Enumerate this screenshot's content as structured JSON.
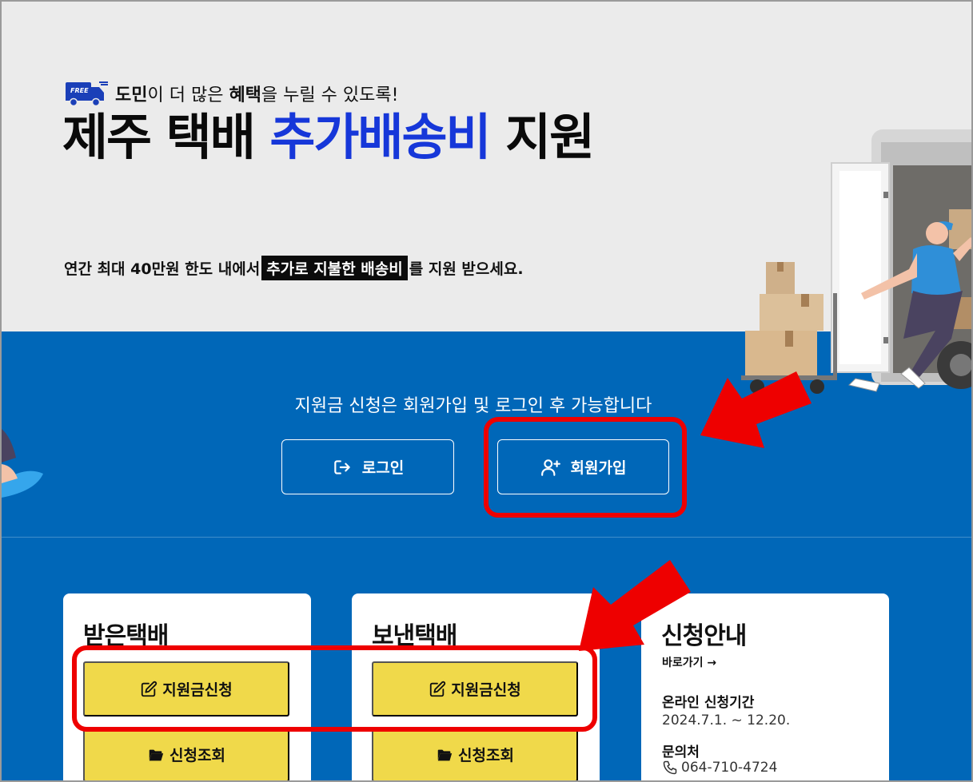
{
  "hero": {
    "badge_text": "FREE",
    "tagline_bold1": "도민",
    "tagline_part1": "이 더 많은 ",
    "tagline_bold2": "혜택",
    "tagline_part2": "을 누릴 수 있도록!",
    "headline_part1": "제주 택배 ",
    "headline_accent": "추가배송비",
    "headline_part2": " 지원",
    "sub_part1": "연간 최대 40만원 한도 내에서 ",
    "sub_highlight": "추가로 지불한 배송비",
    "sub_part2": "를 지원 받으세요."
  },
  "auth": {
    "notice": "지원금 신청은 회원가입 및 로그인 후 가능합니다",
    "login_label": "로그인",
    "signup_label": "회원가입"
  },
  "received": {
    "title": "받은택배",
    "apply_label": "지원금신청",
    "lookup_label": "신청조회"
  },
  "sent": {
    "title": "보낸택배",
    "apply_label": "지원금신청",
    "lookup_label": "신청조회"
  },
  "guide": {
    "title": "신청안내",
    "link_label": "바로가기 →",
    "period_label": "온라인 신청기간",
    "period_value": "2024.7.1. ~ 12.20.",
    "contact_label": "문의처",
    "contact_value": "064-710-4724"
  },
  "colors": {
    "band_blue": "#0067b8",
    "accent_blue": "#1637d9",
    "button_yellow": "#f0d94a",
    "annotation_red": "#ee0000"
  }
}
